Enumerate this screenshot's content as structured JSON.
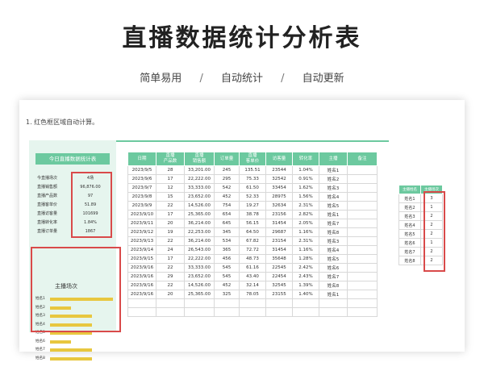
{
  "header": {
    "title": "直播数据统计分析表",
    "features": [
      "简单易用",
      "自动统计",
      "自动更新"
    ],
    "separator": "/"
  },
  "note": "1. 红色框区域自动计算。",
  "panel": {
    "title": "今日直播数据统计表",
    "stats": [
      {
        "label": "今直播场次",
        "value": "4场"
      },
      {
        "label": "直播销售额",
        "value": "96,876.00"
      },
      {
        "label": "直播产品数",
        "value": "97"
      },
      {
        "label": "直播客单价",
        "value": "51.89"
      },
      {
        "label": "直播访客量",
        "value": "101699"
      },
      {
        "label": "直播转化率",
        "value": "1.84%"
      },
      {
        "label": "直播订单量",
        "value": "1867"
      }
    ],
    "rank_title": "主播场次",
    "rank": [
      {
        "name": "姓名1",
        "value": 3
      },
      {
        "name": "姓名2",
        "value": 1
      },
      {
        "name": "姓名3",
        "value": 2
      },
      {
        "name": "姓名4",
        "value": 2
      },
      {
        "name": "姓名5",
        "value": 2
      },
      {
        "name": "姓名6",
        "value": 1
      },
      {
        "name": "姓名7",
        "value": 2
      },
      {
        "name": "姓名8",
        "value": 2
      }
    ],
    "bar_color": "#e8c73f"
  },
  "table": {
    "headers": [
      "日期",
      "直播\n产品数",
      "直播\n销售额",
      "订单量",
      "直播\n客单价",
      "访客量",
      "转化率",
      "主播",
      "备注"
    ],
    "rows": [
      [
        "2023/9/5",
        "28",
        "33,201.00",
        "245",
        "135.51",
        "23544",
        "1.04%",
        "姓名1",
        ""
      ],
      [
        "2023/9/6",
        "17",
        "22,222.00",
        "295",
        "75.33",
        "32542",
        "0.91%",
        "姓名2",
        ""
      ],
      [
        "2023/9/7",
        "12",
        "33,333.00",
        "542",
        "61.50",
        "33454",
        "1.62%",
        "姓名3",
        ""
      ],
      [
        "2023/9/8",
        "15",
        "23,652.00",
        "452",
        "52.33",
        "28975",
        "1.56%",
        "姓名4",
        ""
      ],
      [
        "2023/9/9",
        "22",
        "14,526.00",
        "754",
        "19.27",
        "32634",
        "2.31%",
        "姓名5",
        ""
      ],
      [
        "2023/9/10",
        "17",
        "25,365.00",
        "654",
        "38.78",
        "23156",
        "2.82%",
        "姓名1",
        ""
      ],
      [
        "2023/9/11",
        "20",
        "36,214.00",
        "645",
        "56.15",
        "31454",
        "2.05%",
        "姓名7",
        ""
      ],
      [
        "2023/9/12",
        "19",
        "22,253.00",
        "345",
        "64.50",
        "29687",
        "1.16%",
        "姓名8",
        ""
      ],
      [
        "2023/9/13",
        "22",
        "36,214.00",
        "534",
        "67.82",
        "23154",
        "2.31%",
        "姓名3",
        ""
      ],
      [
        "2023/9/14",
        "24",
        "26,543.00",
        "365",
        "72.72",
        "31454",
        "1.16%",
        "姓名4",
        ""
      ],
      [
        "2023/9/15",
        "17",
        "22,222.00",
        "456",
        "48.73",
        "35648",
        "1.28%",
        "姓名5",
        ""
      ],
      [
        "2023/9/16",
        "22",
        "33,333.00",
        "545",
        "61.16",
        "22545",
        "2.42%",
        "姓名6",
        ""
      ],
      [
        "2023/9/16",
        "29",
        "23,652.00",
        "545",
        "43.40",
        "22454",
        "2.43%",
        "姓名7",
        ""
      ],
      [
        "2023/9/16",
        "22",
        "14,526.00",
        "452",
        "32.14",
        "32545",
        "1.39%",
        "姓名8",
        ""
      ],
      [
        "2023/9/16",
        "20",
        "25,365.00",
        "325",
        "78.05",
        "23155",
        "1.40%",
        "姓名1",
        ""
      ],
      [
        "",
        "",
        "",
        "",
        "",
        "",
        "",
        "",
        ""
      ],
      [
        "",
        "",
        "",
        "",
        "",
        "",
        "",
        "",
        ""
      ]
    ]
  },
  "right_table": {
    "headers": [
      "主播姓名",
      "主播场次"
    ],
    "rows": [
      [
        "姓名1",
        "3"
      ],
      [
        "姓名2",
        "1"
      ],
      [
        "姓名3",
        "2"
      ],
      [
        "姓名4",
        "2"
      ],
      [
        "姓名5",
        "2"
      ],
      [
        "姓名6",
        "1"
      ],
      [
        "姓名7",
        "2"
      ],
      [
        "姓名8",
        "2"
      ]
    ]
  },
  "colors": {
    "accent": "#6cc99f",
    "panel_bg": "#e6f5ee",
    "highlight_border": "#d94a4a"
  }
}
